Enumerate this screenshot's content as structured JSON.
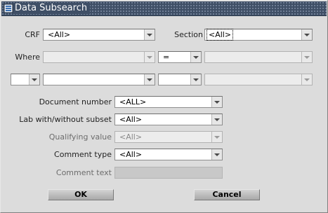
{
  "window": {
    "title": "Data Subsearch"
  },
  "row1": {
    "crf_label": "CRF",
    "crf_value": "<All>",
    "section_label": "Section",
    "section_value": "<All>"
  },
  "row2": {
    "where_label": "Where",
    "field_value": "",
    "operator_value": "=",
    "value_value": ""
  },
  "row3": {
    "paren_value": "",
    "field_value": "",
    "op_value": "",
    "value_value": ""
  },
  "form": {
    "document_number_label": "Document number",
    "document_number_value": "<ALL>",
    "lab_subset_label": "Lab with/without subset",
    "lab_subset_value": "<All>",
    "qualifying_label": "Qualifying value",
    "qualifying_value": "<All>",
    "comment_type_label": "Comment type",
    "comment_type_value": "<All>",
    "comment_text_label": "Comment text",
    "comment_text_value": ""
  },
  "buttons": {
    "ok": "OK",
    "cancel": "Cancel"
  },
  "colors": {
    "title_bg": "#3f4f66",
    "window_bg": "#dcdcdc",
    "disabled_field": "#c8c8c8"
  },
  "icons": {
    "title_icon": "database-icon",
    "dropdown": "chevron-down-icon"
  }
}
